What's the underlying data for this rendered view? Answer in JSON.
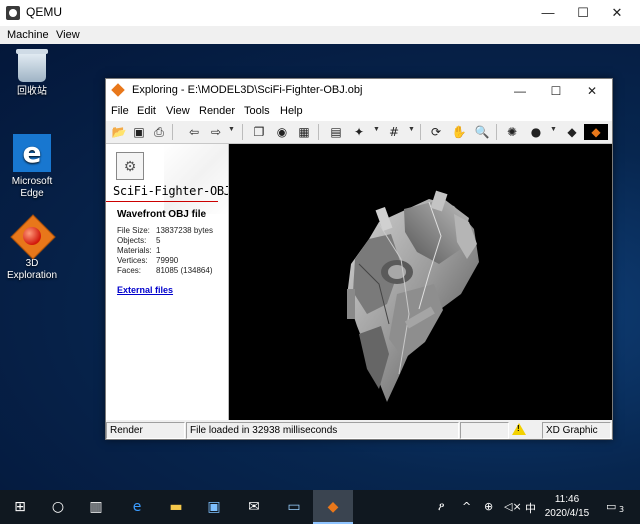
{
  "qemu": {
    "title": "QEMU",
    "menu": [
      "Machine",
      "View"
    ],
    "controls": {
      "minimize": "—",
      "maximize": "☐",
      "close": "✕"
    }
  },
  "desktop": {
    "icons": [
      {
        "label": "回收站",
        "icon": "recycle-bin-icon"
      },
      {
        "label": "Microsoft Edge",
        "icon": "edge-icon"
      },
      {
        "label": "3D Exploration",
        "icon": "3d-exploration-icon"
      }
    ]
  },
  "explorer": {
    "title": "Exploring - E:\\MODEL3D\\SciFi-Fighter-OBJ.obj",
    "menu": [
      "File",
      "Edit",
      "View",
      "Render",
      "Tools",
      "Help"
    ],
    "controls": {
      "minimize": "—",
      "maximize": "☐",
      "close": "✕"
    },
    "info": {
      "filename": "SciFi-Fighter-OBJ.",
      "format": "Wavefront OBJ file",
      "stats": [
        {
          "label": "File Size:",
          "value": "13837238 bytes"
        },
        {
          "label": "Objects:",
          "value": "5"
        },
        {
          "label": "Materials:",
          "value": "1"
        },
        {
          "label": "Vertices:",
          "value": "79990"
        },
        {
          "label": "Faces:",
          "value": "81085 (134864)"
        }
      ],
      "link": "External files"
    },
    "status": {
      "mode": "Render",
      "message": "File loaded in 32938 milliseconds",
      "renderer": "XD Graphic"
    }
  },
  "taskbar": {
    "time": "11:46",
    "date": "2020/4/15",
    "ime": "中",
    "notification_count": "3"
  },
  "colors": {
    "desktop_blue": "#07264f",
    "taskbar": "#101820",
    "link": "#0000cc",
    "warning": "#f3d100",
    "accent_orange": "#e8771a"
  }
}
